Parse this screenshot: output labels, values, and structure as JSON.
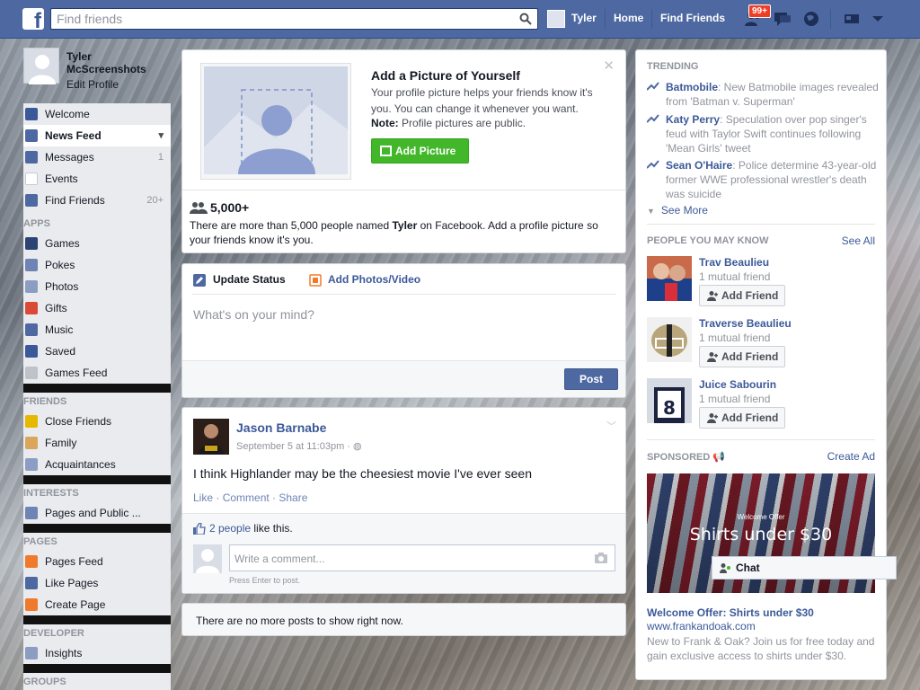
{
  "header": {
    "search_placeholder": "Find friends",
    "user_name": "Tyler",
    "home": "Home",
    "find_friends": "Find Friends",
    "friend_requests_badge": "99+"
  },
  "sidebar": {
    "name": "Tyler McScreenshots",
    "name_line1": "Tyler",
    "name_line2": "McScreenshots",
    "edit_profile": "Edit Profile",
    "main_items": [
      {
        "label": "Welcome",
        "count": ""
      },
      {
        "label": "News Feed",
        "count": ""
      },
      {
        "label": "Messages",
        "count": "1"
      },
      {
        "label": "Events",
        "count": ""
      },
      {
        "label": "Find Friends",
        "count": "20+"
      }
    ],
    "apps_heading": "APPS",
    "apps": [
      "Games",
      "Pokes",
      "Photos",
      "Gifts",
      "Music",
      "Saved",
      "Games Feed"
    ],
    "friends_heading": "FRIENDS",
    "friends": [
      "Close Friends",
      "Family",
      "Acquaintances"
    ],
    "interests_heading": "INTERESTS",
    "interests": [
      "Pages and Public ..."
    ],
    "pages_heading": "PAGES",
    "pages": [
      "Pages Feed",
      "Like Pages",
      "Create Page"
    ],
    "developer_heading": "DEVELOPER",
    "developer": [
      "Insights"
    ],
    "groups_heading": "GROUPS"
  },
  "add_picture": {
    "title": "Add a Picture of Yourself",
    "text": "Your profile picture helps your friends know it's you. You can change it whenever you want.",
    "note_label": "Note:",
    "note_text": " Profile pictures are public.",
    "button": "Add Picture",
    "count": "5,000+",
    "count_text_1": "There are more than 5,000 people named ",
    "count_name": "Tyler",
    "count_text_2": " on Facebook. Add a profile picture so your friends know it's you."
  },
  "composer": {
    "tab_status": "Update Status",
    "tab_photos": "Add Photos/Video",
    "placeholder": "What's on your mind?",
    "post": "Post"
  },
  "post": {
    "author": "Jason Barnabe",
    "time": "September 5 at 11:03pm · ",
    "text": "I think Highlander may be the cheesiest movie I've ever seen",
    "like": "Like",
    "comment": "Comment",
    "share": "Share",
    "likes_link": "2 people",
    "likes_text": " like this.",
    "comment_placeholder": "Write a comment...",
    "comment_hint": "Press Enter to post."
  },
  "no_more_posts": "There are no more posts to show right now.",
  "trending": {
    "heading": "TRENDING",
    "items": [
      {
        "topic": "Batmobile",
        "text": ": New Batmobile images revealed from 'Batman v. Superman'"
      },
      {
        "topic": "Katy Perry",
        "text": ": Speculation over pop singer's feud with Taylor Swift continues following 'Mean Girls' tweet"
      },
      {
        "topic": "Sean O'Haire",
        "text": ": Police determine 43-year-old former WWE professional wrestler's death was suicide"
      }
    ],
    "see_more": "See More"
  },
  "pymk": {
    "heading": "PEOPLE YOU MAY KNOW",
    "see_all": "See All",
    "people": [
      {
        "name": "Trav Beaulieu",
        "mutual": "1 mutual friend",
        "button": "Add Friend"
      },
      {
        "name": "Traverse Beaulieu",
        "mutual": "1 mutual friend",
        "button": "Add Friend"
      },
      {
        "name": "Juice Sabourin",
        "mutual": "1 mutual friend",
        "button": "Add Friend"
      }
    ]
  },
  "sponsored": {
    "heading": "SPONSORED",
    "create_ad": "Create Ad",
    "img_small": "Welcome Offer",
    "img_big": "Shirts under $30",
    "title": "Welcome Offer: Shirts under $30",
    "url": "www.frankandoak.com",
    "desc": "New to Frank & Oak? Join us for free today and gain exclusive access to shirts under $30."
  },
  "chat_label": "Chat",
  "colors": {
    "brand": "#4e69a2",
    "link": "#3b5998",
    "green": "#42b72a",
    "badge": "#f03d25"
  }
}
